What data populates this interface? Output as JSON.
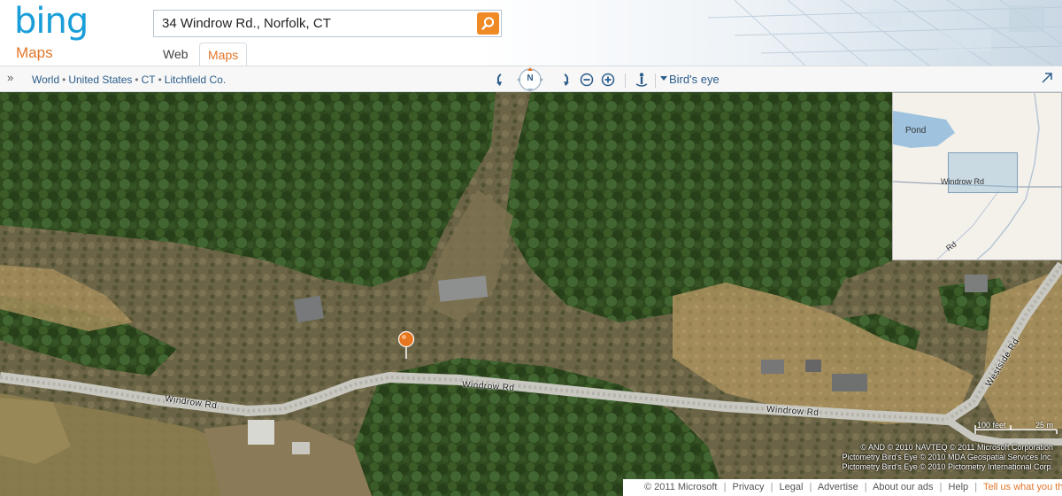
{
  "header": {
    "logo_text": "bing",
    "logo_sub": "Maps",
    "search_value": "34 Windrow Rd., Norfolk, CT",
    "search_icon": "search-icon",
    "tabs": [
      {
        "label": "Web",
        "active": false
      },
      {
        "label": "Maps",
        "active": true
      }
    ],
    "accent_color": "#e2762a",
    "brand_color": "#1a9ed9"
  },
  "toolbar": {
    "breadcrumb": [
      "World",
      "United States",
      "CT",
      "Litchfield Co."
    ],
    "compass_label": "N",
    "view_label": "Bird's eye"
  },
  "map": {
    "road_labels": [
      {
        "text": "Windrow Rd"
      },
      {
        "text": "Windrow Rd"
      },
      {
        "text": "Windrow Rd"
      },
      {
        "text": "Westside Rd"
      }
    ],
    "minimap": {
      "labels": [
        "Pond",
        "Windrow Rd",
        "Rd"
      ]
    },
    "scale": {
      "feet": "100 feet",
      "meters": "25 m"
    },
    "copyright_lines": [
      "© AND  © 2010 NAVTEQ  © 2011 Microsoft Corporation",
      "Pictometry Bird's Eye © 2010 MDA Geospatial Services Inc.",
      "Pictometry Bird's Eye © 2010 Pictometry International Corp."
    ]
  },
  "footer": {
    "copyright": "© 2011 Microsoft",
    "links": [
      "Privacy",
      "Legal",
      "Advertise",
      "About our ads",
      "Help"
    ],
    "feedback": "Tell us what you think"
  }
}
